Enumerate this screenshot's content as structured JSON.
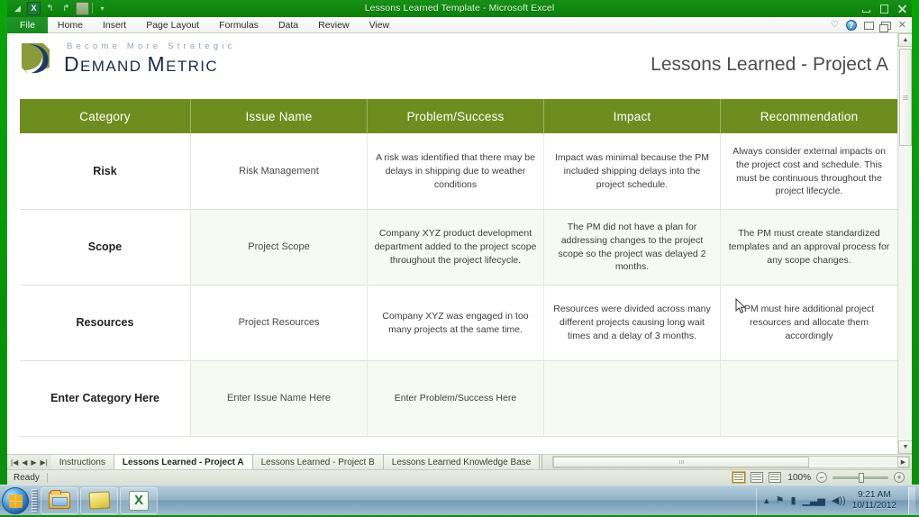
{
  "window": {
    "title": "Lessons Learned Template - Microsoft Excel",
    "quick_access": [
      {
        "name": "excel-icon",
        "glyph": ""
      },
      {
        "name": "save-icon",
        "glyph": ""
      },
      {
        "name": "undo-icon",
        "glyph": "↰"
      },
      {
        "name": "redo-icon",
        "glyph": "↱"
      },
      {
        "name": "print-preview-icon",
        "glyph": ""
      },
      {
        "name": "customize-qat-icon",
        "glyph": "▾"
      }
    ],
    "controls": {
      "minimize": "Minimize",
      "maximize": "Maximize",
      "close": "Close"
    }
  },
  "ribbon": {
    "tabs": [
      {
        "label": "File",
        "active_file": true
      },
      {
        "label": "Home",
        "active_file": false
      },
      {
        "label": "Insert",
        "active_file": false
      },
      {
        "label": "Page Layout",
        "active_file": false
      },
      {
        "label": "Formulas",
        "active_file": false
      },
      {
        "label": "Data",
        "active_file": false
      },
      {
        "label": "Review",
        "active_file": false
      },
      {
        "label": "View",
        "active_file": false
      }
    ],
    "right_icons": [
      {
        "name": "heart-icon",
        "glyph": "♡"
      },
      {
        "name": "help-icon",
        "glyph": "?"
      },
      {
        "name": "restore-ribbon-icon",
        "glyph": ""
      },
      {
        "name": "restore-window-icon",
        "glyph": ""
      },
      {
        "name": "close-workbook-icon",
        "glyph": "✕"
      }
    ]
  },
  "branding": {
    "tagline": "Become More Strategic",
    "name_prefix": "D",
    "name_rest_1": "EMAND ",
    "name_prefix_2": "M",
    "name_rest_2": "ETRIC",
    "logo_icon": "demand-metric-logo"
  },
  "document": {
    "title": "Lessons Learned - Project A"
  },
  "table": {
    "headers": [
      "Category",
      "Issue Name",
      "Problem/Success",
      "Impact",
      "Recommendation"
    ],
    "rows": [
      {
        "category": "Risk",
        "issue": "Risk Management",
        "problem": "A risk was identified that there may be delays in shipping due to weather conditions",
        "impact": "Impact was minimal because the PM included shipping delays into the project schedule.",
        "recommendation": "Always consider external impacts on the project cost and schedule. This must be continuous throughout the project lifecycle."
      },
      {
        "category": "Scope",
        "issue": "Project Scope",
        "problem": "Company XYZ product development department added to the project scope throughout the project lifecycle.",
        "impact": "The PM did not have a plan for addressing changes to the project scope so the project was delayed 2 months.",
        "recommendation": "The PM must create standardized templates and an approval process for any scope changes."
      },
      {
        "category": "Resources",
        "issue": "Project Resources",
        "problem": "Company XYZ was engaged in too many projects at the same time.",
        "impact": "Resources were divided across many different projects causing long wait times and a delay of 3 months.",
        "recommendation": "PM must hire additional project resources and allocate them accordingly"
      },
      {
        "category": "Enter Category Here",
        "issue": "Enter Issue Name Here",
        "problem": "Enter Problem/Success Here",
        "impact": "",
        "recommendation": ""
      }
    ]
  },
  "sheet_tabs": {
    "nav": [
      {
        "name": "first-sheet-button",
        "glyph": "|◀"
      },
      {
        "name": "prev-sheet-button",
        "glyph": "◀"
      },
      {
        "name": "next-sheet-button",
        "glyph": "▶"
      },
      {
        "name": "last-sheet-button",
        "glyph": "▶|"
      }
    ],
    "tabs": [
      {
        "label": "Instructions",
        "active": false
      },
      {
        "label": "Lessons Learned - Project A",
        "active": true
      },
      {
        "label": "Lessons Learned - Project B",
        "active": false
      },
      {
        "label": "Lessons Learned Knowledge Base",
        "active": false
      }
    ]
  },
  "status_bar": {
    "state": "Ready",
    "views": [
      {
        "name": "normal-view-button",
        "selected": true
      },
      {
        "name": "page-layout-view-button",
        "selected": false
      },
      {
        "name": "page-break-preview-button",
        "selected": false
      }
    ],
    "zoom_level": "100%",
    "zoom_out": "−",
    "zoom_in": "+"
  },
  "taskbar": {
    "start": "Start",
    "items": [
      {
        "name": "taskbar-explorer",
        "icon": "folder-explorer-icon"
      },
      {
        "name": "taskbar-notepad",
        "icon": "notepad-icon"
      },
      {
        "name": "taskbar-excel",
        "icon": "excel-icon"
      }
    ],
    "tray_icons": [
      {
        "name": "tray-overflow-icon",
        "glyph": "▴"
      },
      {
        "name": "tray-action-center-icon",
        "glyph": "⚑"
      },
      {
        "name": "tray-network-icon",
        "glyph": "▮"
      },
      {
        "name": "tray-signal-icon",
        "glyph": "▁▃▅"
      },
      {
        "name": "tray-volume-icon",
        "glyph": "◀))"
      }
    ],
    "clock_time": "9:21 AM",
    "clock_date": "10/11/2012"
  },
  "colors": {
    "header_green": "#6d8e1f",
    "title_green": "#0f8a0f",
    "desktop_green": "#069406",
    "brand_navy": "#1b2a4a"
  }
}
